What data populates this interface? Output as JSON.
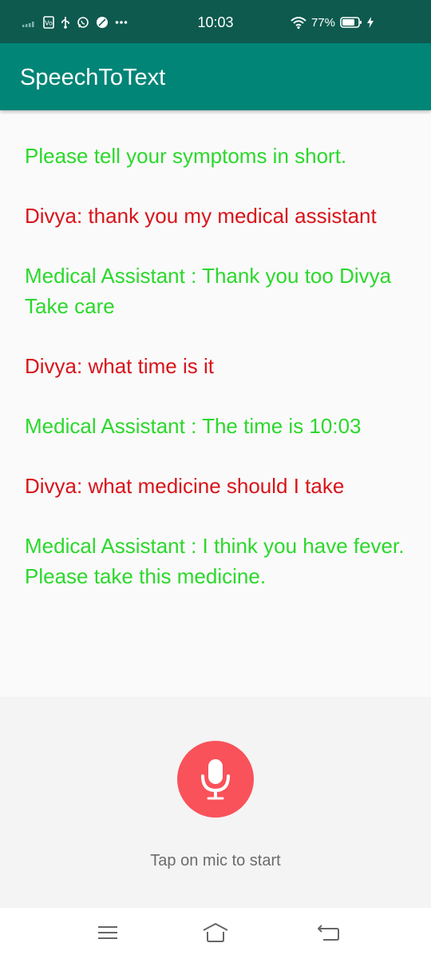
{
  "status_bar": {
    "time": "10:03",
    "battery_percent": "77%",
    "left_icons": [
      "signal-icon",
      "sim-icon",
      "usb-icon",
      "whatsapp-icon",
      "leaf-icon",
      "more-dots-icon"
    ],
    "right_icons": [
      "wifi-icon",
      "battery-icon",
      "charging-icon"
    ]
  },
  "app_bar": {
    "title": "SpeechToText"
  },
  "conversation": {
    "messages": [
      {
        "speaker": "assistant",
        "text": "Please tell your symptoms in short."
      },
      {
        "speaker": "user",
        "text": "Divya: thank you my medical assistant"
      },
      {
        "speaker": "assistant",
        "text": "Medical Assistant : Thank you too Divya Take care"
      },
      {
        "speaker": "user",
        "text": "Divya: what time is it"
      },
      {
        "speaker": "assistant",
        "text": "Medical Assistant : The time is 10:03"
      },
      {
        "speaker": "user",
        "text": "Divya: what medicine should I take"
      },
      {
        "speaker": "assistant",
        "text": "Medical Assistant : I think you have fever. Please take this medicine."
      }
    ]
  },
  "mic_panel": {
    "icon": "microphone-icon",
    "hint": "Tap on mic to start"
  },
  "nav_bar": {
    "buttons": [
      "menu-icon",
      "home-icon",
      "back-icon"
    ]
  },
  "colors": {
    "status_bar": "#0e5a4f",
    "app_bar": "#008577",
    "assistant_text": "#2cd82c",
    "user_text": "#d8141a",
    "mic_button": "#f9525a",
    "hint_text": "#6b6b6b"
  }
}
